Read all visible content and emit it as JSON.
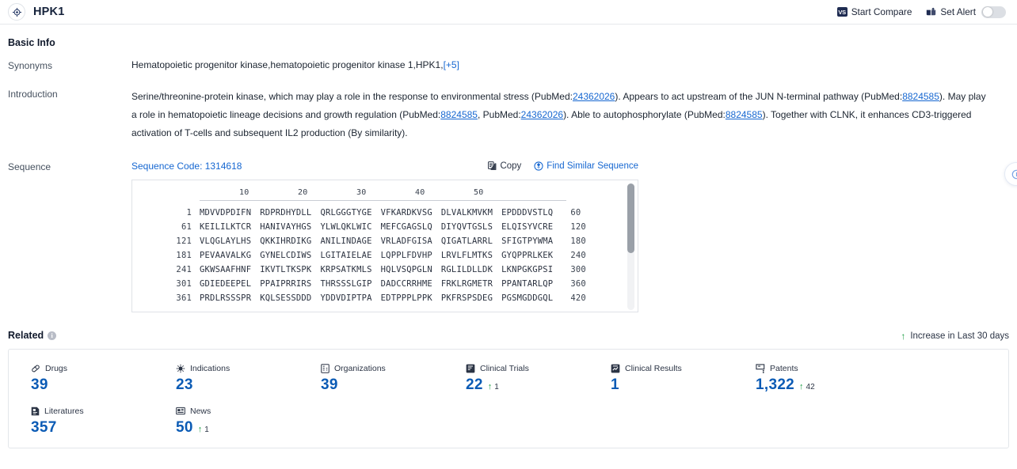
{
  "header": {
    "logo_icon": "target-icon",
    "title": "HPK1",
    "start_compare_label": "Start Compare",
    "vs_badge": "VS",
    "set_alert_label": "Set Alert",
    "alert_toggle_state": "off"
  },
  "basic_info": {
    "section_title": "Basic Info",
    "synonyms": {
      "label": "Synonyms",
      "text": "Hematopoietic progenitor kinase,hematopoietic progenitor kinase 1,HPK1,",
      "more_link": "[+5]"
    },
    "introduction": {
      "label": "Introduction",
      "parts": [
        {
          "t": "text",
          "v": "Serine/threonine-protein kinase, which may play a role in the response to environmental stress (PubMed:"
        },
        {
          "t": "link",
          "v": "24362026"
        },
        {
          "t": "text",
          "v": "). Appears to act upstream of the JUN N-terminal pathway (PubMed:"
        },
        {
          "t": "link",
          "v": "8824585"
        },
        {
          "t": "text",
          "v": "). May play a role in hematopoietic lineage decisions and growth regulation (PubMed:"
        },
        {
          "t": "link",
          "v": "8824585"
        },
        {
          "t": "text",
          "v": ", PubMed:"
        },
        {
          "t": "link",
          "v": "24362026"
        },
        {
          "t": "text",
          "v": "). Able to autophosphorylate (PubMed:"
        },
        {
          "t": "link",
          "v": "8824585"
        },
        {
          "t": "text",
          "v": "). Together with CLNK, it enhances CD3-triggered activation of T-cells and subsequent IL2 production (By similarity)."
        }
      ]
    },
    "sequence": {
      "label": "Sequence",
      "code_label": "Sequence Code: 1314618",
      "copy_label": "Copy",
      "find_similar_label": "Find Similar Sequence",
      "ruler_ticks": [
        "10",
        "20",
        "30",
        "40",
        "50"
      ],
      "lines": [
        {
          "start": "1",
          "chunks": [
            "MDVVDPDIFN",
            "RDPRDHYDLL",
            "QRLGGGTYGE",
            "VFKARDKVSG",
            "DLVALKMVKM",
            "EPDDDVSTLQ"
          ],
          "end": "60"
        },
        {
          "start": "61",
          "chunks": [
            "KEILILKTCR",
            "HANIVAYHGS",
            "YLWLQKLWIC",
            "MEFCGAGSLQ",
            "DIYQVTGSLS",
            "ELQISYVCRE"
          ],
          "end": "120"
        },
        {
          "start": "121",
          "chunks": [
            "VLQGLAYLHS",
            "QKKIHRDIKG",
            "ANILINDAGE",
            "VRLADFGISA",
            "QIGATLARRL",
            "SFIGTPYWMA"
          ],
          "end": "180"
        },
        {
          "start": "181",
          "chunks": [
            "PEVAAVALKG",
            "GYNELCDIWS",
            "LGITAIELAE",
            "LQPPLFDVHP",
            "LRVLFLMTKS",
            "GYQPPRLKEK"
          ],
          "end": "240"
        },
        {
          "start": "241",
          "chunks": [
            "GKWSAAFHNF",
            "IKVTLTKSPK",
            "KRPSATKMLS",
            "HQLVSQPGLN",
            "RGLILDLLDK",
            "LKNPGKGPSI"
          ],
          "end": "300"
        },
        {
          "start": "301",
          "chunks": [
            "GDIEDEEPEL",
            "PPAIPRRIRS",
            "THRSSSLGIP",
            "DADCCRRHME",
            "FRKLRGMETR",
            "PPANTARLQP"
          ],
          "end": "360"
        },
        {
          "start": "361",
          "chunks": [
            "PRDLRSSSPR",
            "KQLSESSDDD",
            "YDDVDIPTPA",
            "EDTPPPLPPK",
            "PKFRSPSDEG",
            "PGSMGDDGQL"
          ],
          "end": "420"
        }
      ]
    }
  },
  "related": {
    "section_title": "Related",
    "increase_note": "Increase in Last 30 days",
    "stats": [
      {
        "icon": "capsule-icon",
        "label": "Drugs",
        "value": "39",
        "delta": ""
      },
      {
        "icon": "virus-icon",
        "label": "Indications",
        "value": "23",
        "delta": ""
      },
      {
        "icon": "building-icon",
        "label": "Organizations",
        "value": "39",
        "delta": ""
      },
      {
        "icon": "clinical-trials-icon",
        "label": "Clinical Trials",
        "value": "22",
        "delta": "1"
      },
      {
        "icon": "clinical-results-icon",
        "label": "Clinical Results",
        "value": "1",
        "delta": ""
      },
      {
        "icon": "patents-icon",
        "label": "Patents",
        "value": "1,322",
        "delta": "42"
      },
      {
        "icon": "literatures-icon",
        "label": "Literatures",
        "value": "357",
        "delta": ""
      },
      {
        "icon": "news-icon",
        "label": "News",
        "value": "50",
        "delta": "1"
      }
    ]
  },
  "colors": {
    "link": "#1667d1",
    "stat_value": "#0b5bb5",
    "increase": "#1a9c42",
    "border": "#e3e6ea"
  }
}
